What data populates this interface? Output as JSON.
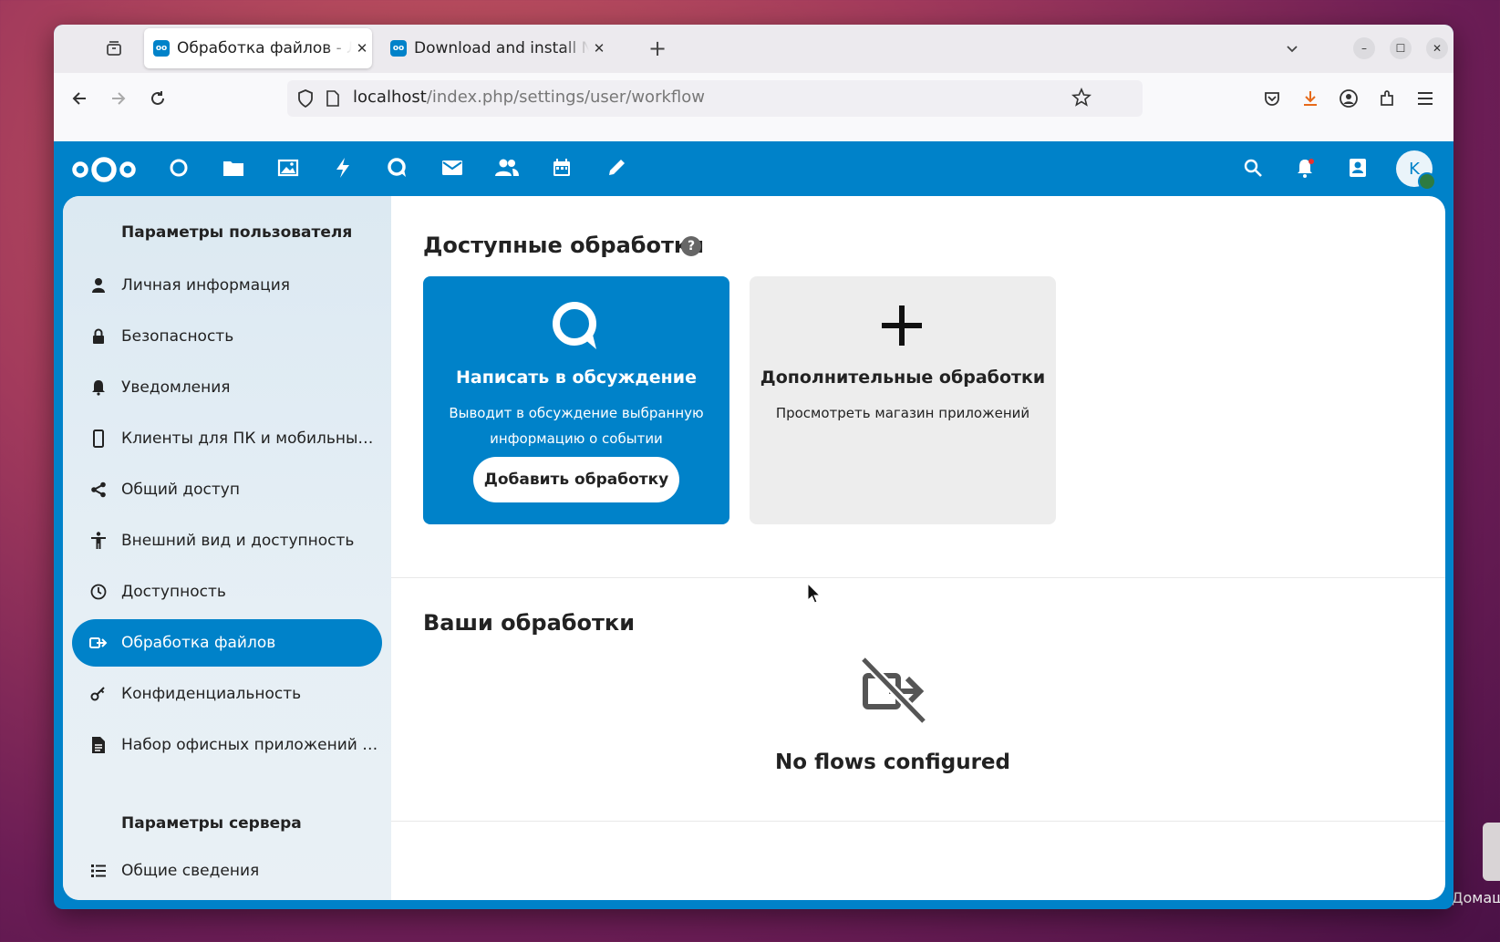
{
  "browser": {
    "tabs": [
      {
        "title": "Обработка файлов - Лич",
        "active": true
      },
      {
        "title": "Download and install Nex",
        "active": false
      }
    ],
    "new_tab": "+",
    "url_host": "localhost",
    "url_path": "/index.php/settings/user/workflow"
  },
  "nextcloud": {
    "accent": "#0082c9",
    "apps": [
      "dashboard-icon",
      "files-icon",
      "photos-icon",
      "activity-icon",
      "talk-icon",
      "mail-icon",
      "contacts-icon",
      "calendar-icon",
      "notes-icon"
    ],
    "avatar_initial": "K"
  },
  "sidebar": {
    "personal_caption": "Параметры пользователя",
    "items": [
      {
        "label": "Личная информация",
        "icon": "person-icon"
      },
      {
        "label": "Безопасность",
        "icon": "lock-icon"
      },
      {
        "label": "Уведомления",
        "icon": "bell-icon"
      },
      {
        "label": "Клиенты для ПК и мобильны…",
        "icon": "phone-icon"
      },
      {
        "label": "Общий доступ",
        "icon": "share-icon"
      },
      {
        "label": "Внешний вид и доступность",
        "icon": "accessibility-icon"
      },
      {
        "label": "Доступность",
        "icon": "clock-icon"
      },
      {
        "label": "Обработка файлов",
        "icon": "workflow-icon",
        "active": true
      },
      {
        "label": "Конфиденциальность",
        "icon": "key-icon"
      },
      {
        "label": "Набор офисных приложений …",
        "icon": "document-icon"
      }
    ],
    "server_caption": "Параметры сервера",
    "server_items": [
      {
        "label": "Общие сведения",
        "icon": "list-icon"
      }
    ]
  },
  "main": {
    "available_title": "Доступные обработки",
    "help": "?",
    "card_talk": {
      "title": "Написать в обсуждение",
      "desc": "Выводит в обсуждение выбранную информацию о событии",
      "button": "Добавить обработку"
    },
    "card_more": {
      "title": "Дополнительные обработки",
      "desc": "Просмотреть магазин приложений"
    },
    "your_title": "Ваши обработки",
    "empty_text": "No flows configured"
  },
  "desktop": {
    "label": "Домаш"
  }
}
